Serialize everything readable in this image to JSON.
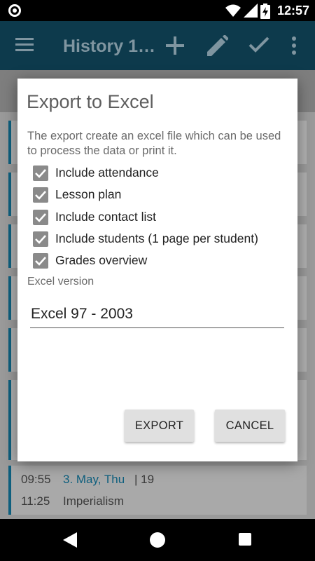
{
  "status_bar": {
    "time": "12:57"
  },
  "app_bar": {
    "title": "History 1…"
  },
  "lesson": {
    "time1": "09:55",
    "date": "3. May, Thu",
    "number": "| 19",
    "time2": "11:25",
    "subject": "Imperialism"
  },
  "dialog": {
    "title": "Export to Excel",
    "description": "The export create an excel file which can be used to process the data or print it.",
    "options": [
      {
        "label": "Include attendance",
        "checked": true
      },
      {
        "label": "Lesson plan",
        "checked": true
      },
      {
        "label": "Include contact list",
        "checked": true
      },
      {
        "label": "Include students (1 page per student)",
        "checked": true
      },
      {
        "label": "Grades overview",
        "checked": true
      }
    ],
    "version_label": "Excel version",
    "version_value": "Excel 97 - 2003",
    "export_label": "EXPORT",
    "cancel_label": "CANCEL"
  },
  "colors": {
    "accent": "#0e5f7e",
    "checkbox": "#8a8a8a"
  }
}
